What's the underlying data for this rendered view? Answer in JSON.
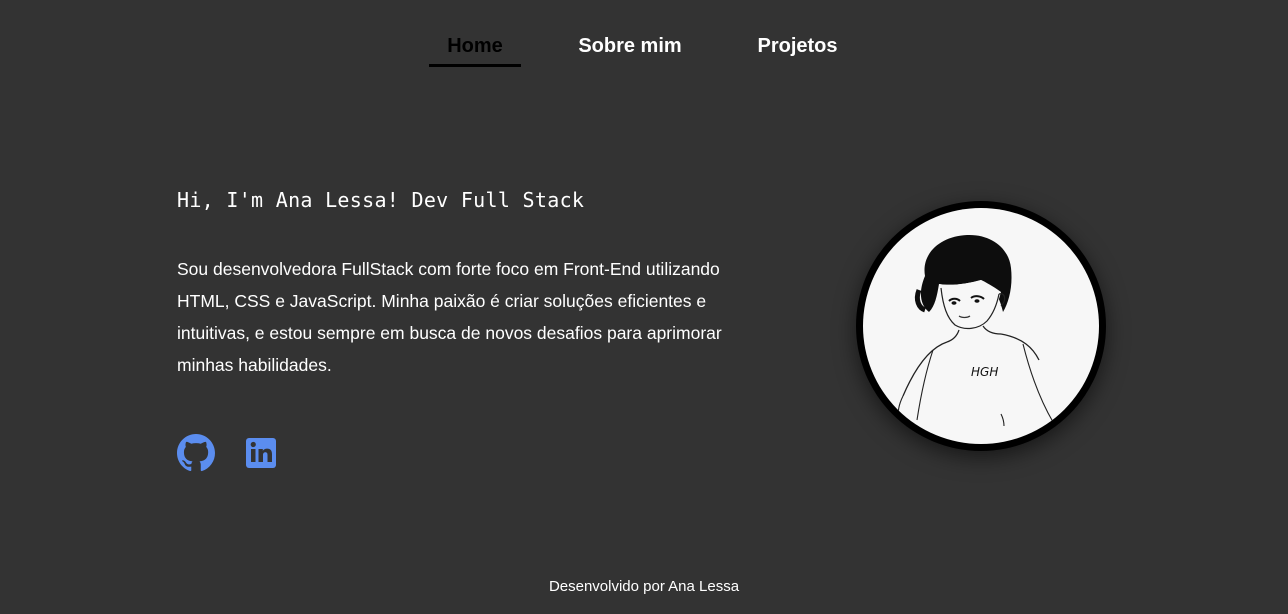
{
  "nav": {
    "items": [
      {
        "label": "Home",
        "active": true
      },
      {
        "label": "Sobre mim",
        "active": false
      },
      {
        "label": "Projetos",
        "active": false
      }
    ]
  },
  "hero": {
    "greeting": "Hi, I'm Ana Lessa! Dev Full Stack",
    "bio": "Sou desenvolvedora FullStack com forte foco em Front-End utilizando HTML, CSS e JavaScript. Minha paixão é criar soluções eficientes e intuitivas, e estou sempre em busca de novos desafios para aprimorar minhas habilidades.",
    "avatar_shirt_text": "HGH"
  },
  "social": [
    {
      "icon": "github-icon",
      "name": "GitHub"
    },
    {
      "icon": "linkedin-icon",
      "name": "LinkedIn"
    }
  ],
  "footer": {
    "text": "Desenvolvido por Ana Lessa"
  },
  "colors": {
    "background": "#333333",
    "text": "#ffffff",
    "active_nav": "#000000",
    "icon_accent": "#5b8def"
  }
}
